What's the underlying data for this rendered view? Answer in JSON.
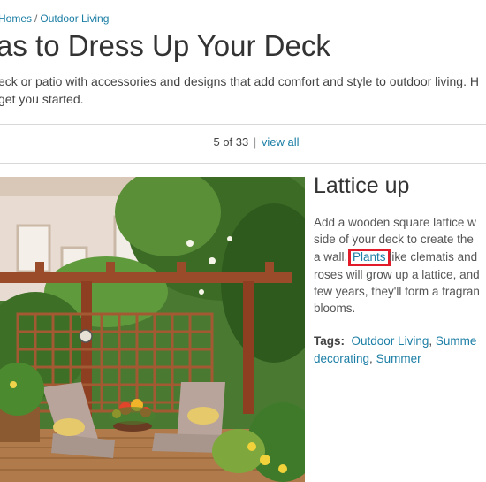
{
  "breadcrumb": {
    "items": [
      "Homes",
      "Outdoor Living"
    ],
    "separator": "/"
  },
  "page_title": "as to Dress Up Your Deck",
  "intro": {
    "line1": "eck or patio with accessories and designs that add comfort and style to outdoor living. H",
    "line2": "get you started."
  },
  "pager": {
    "counter": "5 of 33",
    "separator": "|",
    "view_all_label": "view all"
  },
  "photo": {
    "subject": "wooden deck with red pergola, square lattice, two lounge chairs and potted flowers"
  },
  "slide": {
    "title": "Lattice up",
    "description_lines": [
      "Add a wooden square lattice w",
      "side of your deck to create the",
      "a wall.",
      "like clematis and",
      "roses will grow up a lattice, and",
      "few years, they'll form a fragran",
      "blooms."
    ],
    "plants_link": "Plants"
  },
  "tags": {
    "label": "Tags:",
    "items": [
      "Outdoor Living",
      "Summe",
      "decorating",
      "Summer"
    ],
    "separator": ","
  },
  "colors": {
    "link": "#1b7ea5",
    "highlight_border": "#e21b2b",
    "divider": "#d8d8d8"
  }
}
